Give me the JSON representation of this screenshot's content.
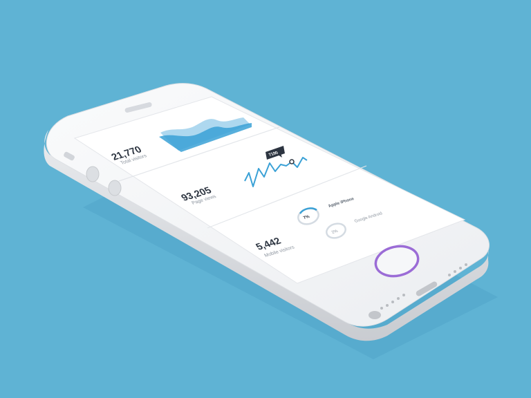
{
  "stats": [
    {
      "value": "21,770",
      "label": "Total visitors"
    },
    {
      "value": "93,205",
      "label": "Page views"
    },
    {
      "value": "5,442",
      "label": "Mobile visitors"
    }
  ],
  "tooltip": {
    "value": "7190"
  },
  "platforms": [
    {
      "percent": "7%",
      "name": "Apple iPhone"
    },
    {
      "percent": "2%",
      "name": "Google Android"
    }
  ],
  "colors": {
    "background": "#5fb3d4",
    "accent_blue": "#3aa1d6",
    "home_ring": "#9b6cd6",
    "device_body": "#f3f4f6"
  }
}
